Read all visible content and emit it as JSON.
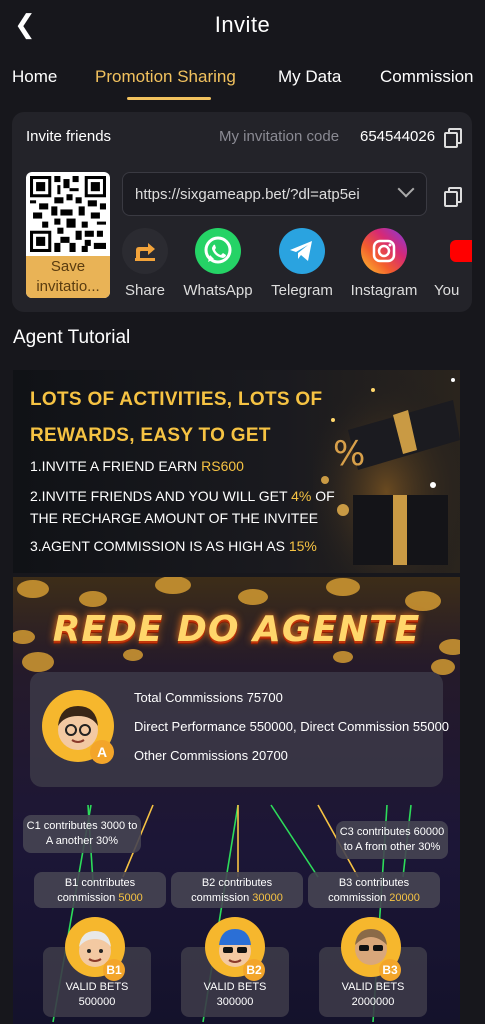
{
  "header": {
    "back_icon": "chevron-left-icon",
    "title": "Invite"
  },
  "tabs": [
    {
      "label": "Home"
    },
    {
      "label": "Promotion Sharing",
      "active": true
    },
    {
      "label": "My Data"
    },
    {
      "label": "Commission"
    }
  ],
  "invite": {
    "label": "Invite friends",
    "code_label": "My invitation code",
    "code": "654544026",
    "link": "https://sixgameapp.bet/?dl=atp5ei",
    "save_label": "Save invitatio..."
  },
  "share": [
    {
      "label": "Share",
      "icon": "share-icon",
      "color": "#2b2b31"
    },
    {
      "label": "WhatsApp",
      "icon": "whatsapp-icon",
      "color": "#25d366"
    },
    {
      "label": "Telegram",
      "icon": "telegram-icon",
      "color": "#2aa3e0"
    },
    {
      "label": "Instagram",
      "icon": "instagram-icon",
      "color": "#e4405f"
    },
    {
      "label": "You",
      "icon": "youtube-icon",
      "color": "#ff0000"
    }
  ],
  "tutorial": {
    "title": "Agent Tutorial",
    "banner1": {
      "head1": "LOTS OF ACTIVITIES, LOTS OF",
      "head2": "REWARDS, EASY TO GET",
      "line1_a": "1.INVITE A FRIEND EARN ",
      "line1_b": "RS600",
      "line2_a": "2.INVITE FRIENDS AND YOU WILL GET ",
      "line2_b": "4%",
      "line2_c": " OF",
      "line3": "THE RECHARGE AMOUNT OF THE INVITEE",
      "line4_a": "3.AGENT COMMISSION IS AS HIGH AS ",
      "line4_b": "15%"
    },
    "banner2": {
      "heading": "REDE DO AGENTE",
      "total": "Total Commissions 75700",
      "direct": "Direct Performance 550000, Direct Commission 55000",
      "other": "Other Commissions 20700",
      "badge_a": "A",
      "c1": "C1 contributes 3000 to A another 30%",
      "c3": "C3 contributes 60000 to A from other 30%",
      "contrib_prefix": "contributes",
      "commission_label": "commission",
      "valid_bets_label": "VALID BETS",
      "members": [
        {
          "name": "B1",
          "commission": "5000",
          "bets": "500000"
        },
        {
          "name": "B2",
          "commission": "30000",
          "bets": "300000"
        },
        {
          "name": "B3",
          "commission": "20000",
          "bets": "2000000"
        }
      ]
    }
  },
  "colors": {
    "accent": "#f2c25e",
    "background": "#17171c",
    "card": "#232329"
  }
}
